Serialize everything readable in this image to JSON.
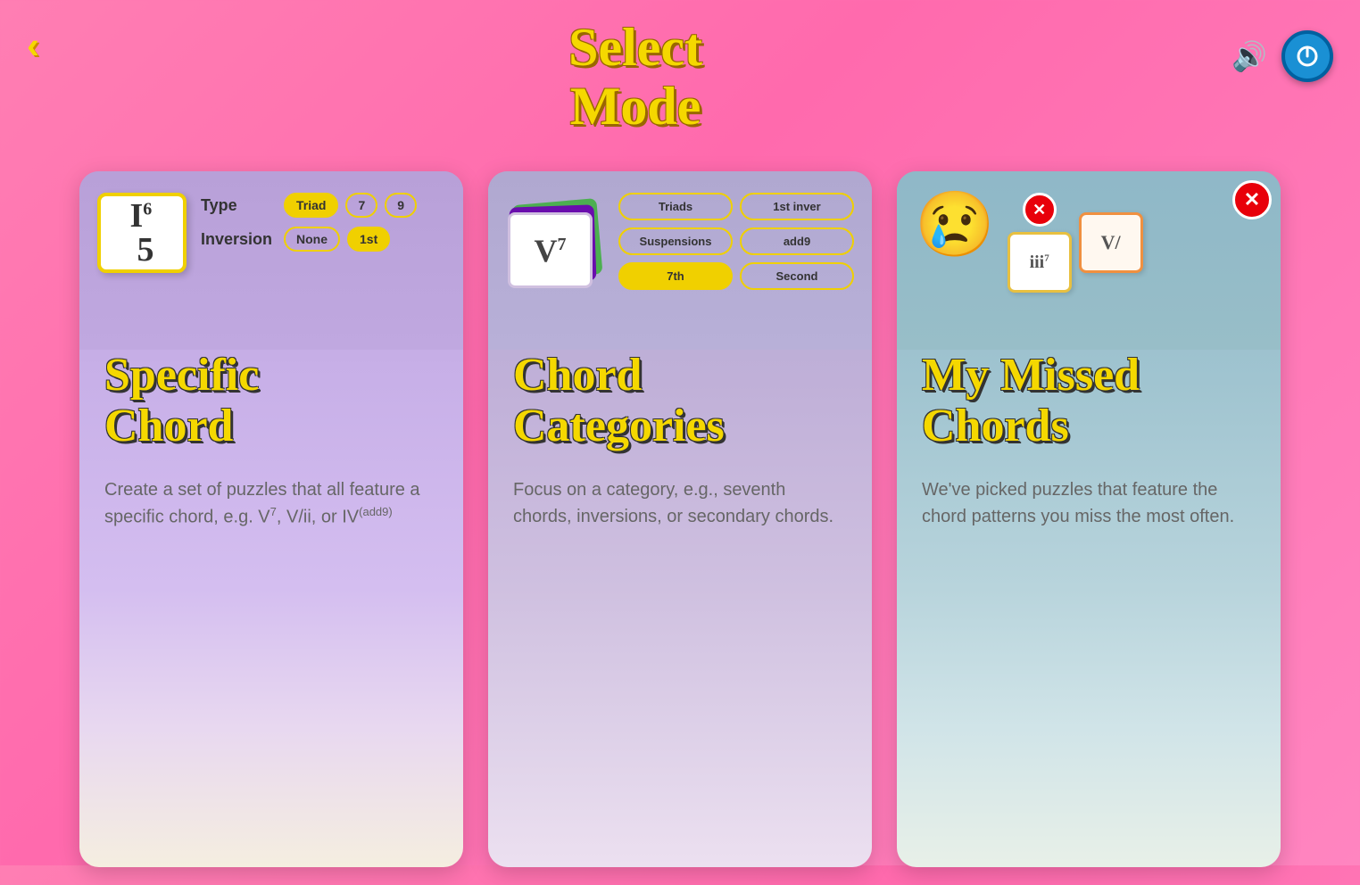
{
  "header": {
    "back_label": "‹",
    "title_line1": "Select",
    "title_line2": "Mode",
    "sound_icon": "🔊",
    "power_icon": "power"
  },
  "cards": [
    {
      "id": "specific-chord",
      "title": "Specific Chord",
      "description": "Create a set of puzzles that all feature a specific chord, e.g. V",
      "description_sup": "7",
      "description_rest": ", V/ii, or IV",
      "description_sup2": "(add9)",
      "flashcard_roman": "I",
      "flashcard_sup": "6",
      "flashcard_sub": "5",
      "type_label": "Type",
      "inversion_label": "Inversion",
      "type_options": [
        "Triad",
        "7",
        "9"
      ],
      "type_active": "Triad",
      "inversion_options": [
        "None",
        "1st"
      ],
      "inversion_active": "1st"
    },
    {
      "id": "chord-categories",
      "title": "Chord Categories",
      "description": "Focus on a category, e.g., seventh chords, inversions, or secondary chords.",
      "flashcard_roman": "V",
      "flashcard_sup": "7",
      "categories": [
        "Triads",
        "1st inver",
        "Suspensions",
        "add9",
        "7th",
        "Second"
      ]
    },
    {
      "id": "missed-chords",
      "title": "My Missed Chords",
      "description": "We've picked puzzles that feature the chord patterns you miss the most often.",
      "flashcard_roman1": "iii",
      "flashcard_sup1": "7",
      "flashcard_roman2": "V/",
      "emoji": "😢"
    }
  ]
}
